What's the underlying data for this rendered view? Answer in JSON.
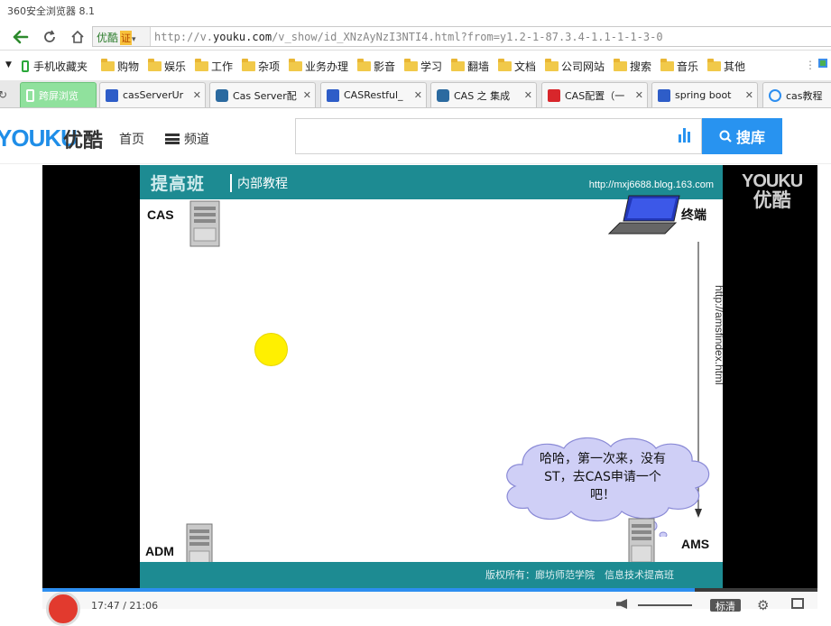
{
  "window": {
    "title": "360安全浏览器 8.1"
  },
  "address_bar": {
    "site_name": "优酷",
    "cert_badge": "证",
    "url_prefix": "http://v.",
    "url_domain": "youku.com",
    "url_rest": "/v_show/id_XNzAyNzI3NTI4.html?from=y1.2-1-87.3.4-1.1-1-1-3-0"
  },
  "bookmarks": [
    {
      "label": "手机收藏夹",
      "icon": "phone-icon"
    },
    {
      "label": "购物",
      "icon": "folder-icon"
    },
    {
      "label": "娱乐",
      "icon": "folder-icon"
    },
    {
      "label": "工作",
      "icon": "folder-icon"
    },
    {
      "label": "杂项",
      "icon": "folder-icon"
    },
    {
      "label": "业务办理",
      "icon": "folder-icon"
    },
    {
      "label": "影音",
      "icon": "folder-icon"
    },
    {
      "label": "学习",
      "icon": "folder-icon"
    },
    {
      "label": "翻墙",
      "icon": "folder-icon"
    },
    {
      "label": "文档",
      "icon": "folder-icon"
    },
    {
      "label": "公司网站",
      "icon": "folder-icon"
    },
    {
      "label": "搜索",
      "icon": "folder-icon"
    },
    {
      "label": "音乐",
      "icon": "folder-icon"
    },
    {
      "label": "其他",
      "icon": "folder-icon"
    }
  ],
  "tabs": [
    {
      "label": "跨屏浏览",
      "active": true,
      "icon": "phone-icon"
    },
    {
      "label": "casServerUr",
      "icon": "baidu-paw-icon"
    },
    {
      "label": "Cas Server配",
      "icon": "c-logo-icon"
    },
    {
      "label": "CASRestful_",
      "icon": "baidu-paw-icon"
    },
    {
      "label": "CAS 之 集成",
      "icon": "c-logo-icon"
    },
    {
      "label": "CAS配置（一",
      "icon": "csdn-icon"
    },
    {
      "label": "spring boot",
      "icon": "baidu-paw-icon"
    },
    {
      "label": "cas教程",
      "icon": "youku-icon"
    }
  ],
  "youku": {
    "logo": "YOUKU",
    "logo_cn": "优酷",
    "nav_home": "首页",
    "nav_channel": "频道",
    "search_placeholder": "",
    "search_button": "搜库",
    "watermark_en": "YOUKU",
    "watermark_cn": "优酷"
  },
  "slide": {
    "brand": "提高班",
    "brand_sub": "内部教程",
    "blog_url": "http://mxj6688.blog.163.com",
    "label_cas": "CAS",
    "label_terminal": "终端",
    "label_adm": "ADM",
    "label_ams": "AMS",
    "request_url": "http://amsfindex.html",
    "bubble_text": "哈哈，第一次来，没有ST，去CAS申请一个吧！",
    "copyright": "版权所有：廊坊师范学院　信息技术提高班"
  },
  "player": {
    "time": "17:47 / 21:06",
    "progress": 0.842,
    "quality": "标清"
  },
  "colors": {
    "slide_teal": "#1d8b92",
    "youku_blue": "#2893f0",
    "active_tab": "#90e19d"
  }
}
